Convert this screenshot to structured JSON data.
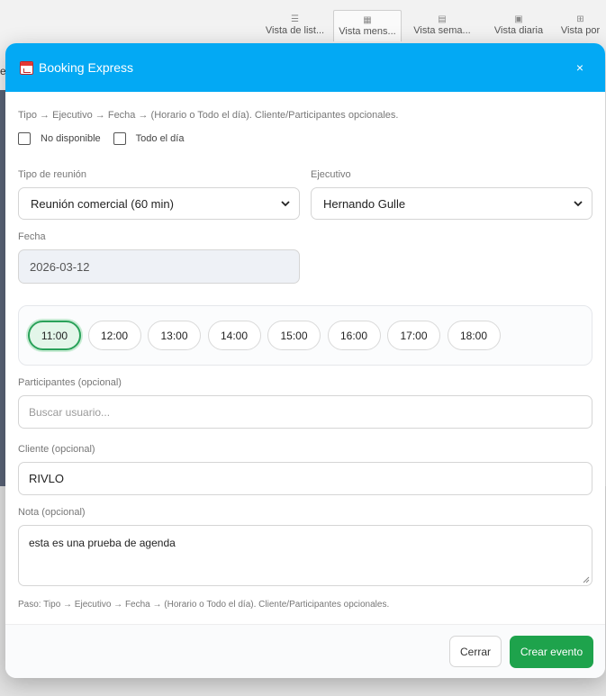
{
  "background": {
    "tabs": [
      {
        "label": "Vista de list...",
        "icon": "list-icon"
      },
      {
        "label": "Vista mens...",
        "icon": "calendar-month-icon",
        "active": true
      },
      {
        "label": "Vista sema...",
        "icon": "calendar-week-icon"
      },
      {
        "label": "Vista diaria",
        "icon": "calendar-day-icon"
      },
      {
        "label": "Vista por",
        "icon": "grid-icon"
      }
    ],
    "left_letter": "e"
  },
  "modal": {
    "title": "Booking Express",
    "close_label": "×",
    "hint_top": "Tipo → Ejecutivo → Fecha → (Horario o Todo el día). Cliente/Participantes opcionales.",
    "checkboxes": {
      "no_disponible": "No disponible",
      "todo_el_dia": "Todo el día"
    },
    "tipo_reunion": {
      "label": "Tipo de reunión",
      "value": "Reunión comercial (60 min)"
    },
    "ejecutivo": {
      "label": "Ejecutivo",
      "value": "Hernando Gulle"
    },
    "fecha": {
      "label": "Fecha",
      "value": "2026-03-12"
    },
    "slots": [
      "11:00",
      "12:00",
      "13:00",
      "14:00",
      "15:00",
      "16:00",
      "17:00",
      "18:00"
    ],
    "selected_slot": "11:00",
    "participantes": {
      "label": "Participantes (opcional)",
      "placeholder": "Buscar usuario..."
    },
    "cliente": {
      "label": "Cliente (opcional)",
      "value": "RIVLO"
    },
    "nota": {
      "label": "Nota (opcional)",
      "value": "esta es una prueba de agenda"
    },
    "hint_bottom": "Paso: Tipo → Ejecutivo → Fecha → (Horario o Todo el día). Cliente/Participantes opcionales.",
    "footer": {
      "cancel_label": "Cerrar",
      "create_label": "Crear evento"
    }
  },
  "colors": {
    "header": "#03a9f4",
    "primary_button": "#1ea34c",
    "selected_slot_border": "#2aa25a"
  }
}
